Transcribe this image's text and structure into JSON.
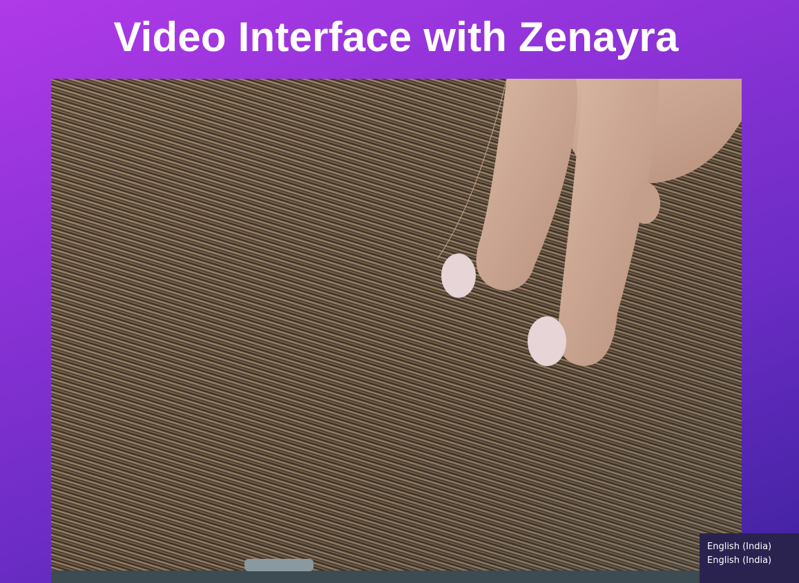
{
  "page": {
    "title": "Video Interface with Zenayra"
  },
  "video": {
    "content": "camera-feed"
  },
  "input_indicator": {
    "line1": "English (India)",
    "line2": "English (India)"
  },
  "colors": {
    "background_start": "#b03ae8",
    "background_end": "#3f22a0",
    "title_text": "#ffffff",
    "popup_background": "#2a2350"
  }
}
